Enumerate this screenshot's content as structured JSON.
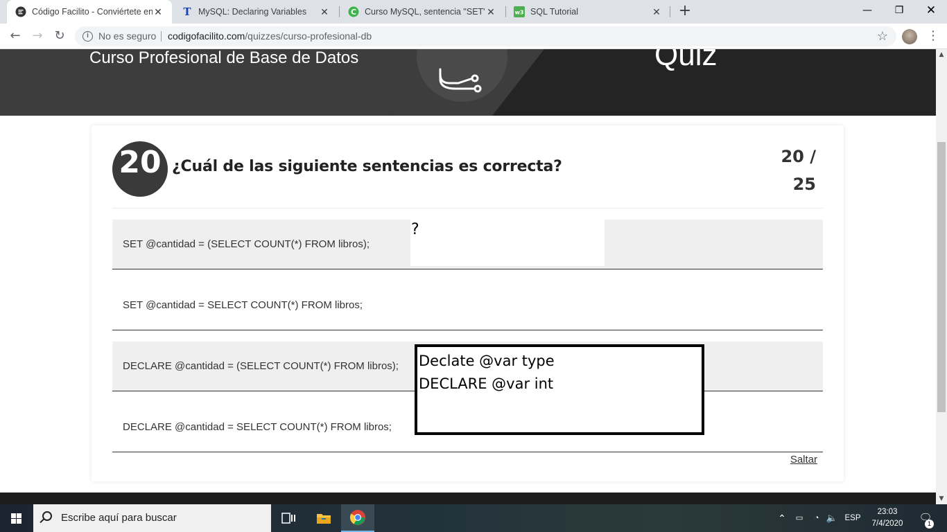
{
  "browser": {
    "tabs": [
      {
        "title": "Código Facilito - Conviértete en p",
        "active": true,
        "favicon": "codigofacilito-icon"
      },
      {
        "title": "MySQL: Declaring Variables",
        "active": false,
        "favicon": "t-letter-icon"
      },
      {
        "title": "Curso MySQL, sentencia \"SET\"",
        "active": false,
        "favicon": "chrome-c-icon"
      },
      {
        "title": "SQL Tutorial",
        "active": false,
        "favicon": "w3schools-icon"
      }
    ],
    "omnibox": {
      "security": "No es seguro",
      "url_domain": "codigofacilito.com",
      "url_path": "/quizzes/curso-profesional-db"
    }
  },
  "page": {
    "hero_title": "Curso Profesional de Base de Datos",
    "hero_quiz": "Quiz",
    "question": {
      "number": "20",
      "text": "¿Cuál de las siguiente sentencias es correcta?",
      "progress_current": "20 /",
      "progress_total": "25"
    },
    "options": [
      "SET @cantidad = (SELECT COUNT(*) FROM libros);",
      "SET @cantidad = SELECT COUNT(*) FROM libros;",
      "DECLARE @cantidad = (SELECT COUNT(*) FROM libros);",
      "DECLARE @cantidad = SELECT COUNT(*) FROM libros;"
    ],
    "skip_label": "Saltar",
    "overlay_question_mark": "?",
    "overlay_note": {
      "line1": "Declate @var type",
      "line2": "DECLARE @var int"
    }
  },
  "taskbar": {
    "search_placeholder": "Escribe aquí para buscar",
    "language": "ESP",
    "time": "23:03",
    "date": "7/4/2020",
    "notification_count": "1"
  },
  "colors": {
    "hero_dark": "#242424",
    "hero_light": "#3d3d3d",
    "option_shaded": "#efefef"
  }
}
